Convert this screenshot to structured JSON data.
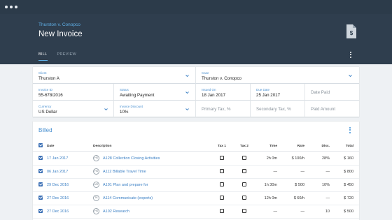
{
  "header": {
    "breadcrumb": "Thurston v. Conopco",
    "title": "New Invoice",
    "tabs": [
      {
        "label": "BILL",
        "active": true
      },
      {
        "label": "PREVIEW",
        "active": false
      }
    ],
    "icons": {
      "document": "document-dollar-icon",
      "menu": "kebab-menu-icon"
    }
  },
  "form": {
    "client": {
      "label": "Client",
      "value": "Thurston A"
    },
    "case": {
      "label": "Case",
      "value": "Thurston v. Conopco"
    },
    "invoice_id": {
      "label": "Invoice ID",
      "value": "55-678/2016"
    },
    "status": {
      "label": "Status",
      "value": "Awaiting Payment"
    },
    "issued_on": {
      "label": "Issued On",
      "value": "18 Jan 2017"
    },
    "due_date": {
      "label": "Due Date",
      "value": "25 Jan 2017"
    },
    "date_paid": {
      "placeholder": "Date Paid"
    },
    "currency": {
      "label": "Currency",
      "value": "US Dollar"
    },
    "invoice_discount": {
      "label": "Invoice Discount",
      "value": "10%"
    },
    "primary_tax": {
      "placeholder": "Primary Tax, %"
    },
    "secondary_tax": {
      "placeholder": "Secondary Tax, %"
    },
    "paid_amount": {
      "placeholder": "Paid Amount"
    }
  },
  "billed": {
    "title": "Billed",
    "columns": {
      "date": "Date",
      "description": "Description",
      "tax1": "Tax 1",
      "tax2": "Tax 2",
      "time": "Time",
      "rate": "Rate",
      "disc": "Disc.",
      "total": "Total"
    },
    "rows": [
      {
        "date": "17 Jan 2017",
        "initials": "HS",
        "description": "A128 Collection Closing Activities",
        "tax1": false,
        "tax2": false,
        "time": "2h 0m",
        "rate": "$ 100/h",
        "disc": "28%",
        "total": "$ 160"
      },
      {
        "date": "06 Jan 2017",
        "initials": "HS",
        "description": "A112 Billable Travel Time",
        "tax1": false,
        "tax2": false,
        "time": "—",
        "rate": "—",
        "disc": "—",
        "total": "$ 800"
      },
      {
        "date": "29 Dec 2016",
        "initials": "UR",
        "description": "A101 Plan and prepare for",
        "tax1": false,
        "tax2": false,
        "time": "1h 30m",
        "rate": "$ 500",
        "disc": "10%",
        "total": "$ 450"
      },
      {
        "date": "27 Dec 2016",
        "initials": "TK",
        "description": "A114 Communicate (experts)",
        "tax1": false,
        "tax2": false,
        "time": "12h 0m",
        "rate": "$ 60/h",
        "disc": "—",
        "total": "$ 720"
      },
      {
        "date": "27 Dec 2016",
        "initials": "HS",
        "description": "A102 Research",
        "tax1": false,
        "tax2": false,
        "time": "—",
        "rate": "—",
        "disc": "10",
        "total": "$ 500"
      }
    ]
  },
  "colors": {
    "header_bg": "#2f3e4e",
    "chrome_bg": "#2c3b4a",
    "accent": "#4a90d0",
    "checkbox": "#3a6fb5",
    "page_bg": "#eef1f4"
  }
}
